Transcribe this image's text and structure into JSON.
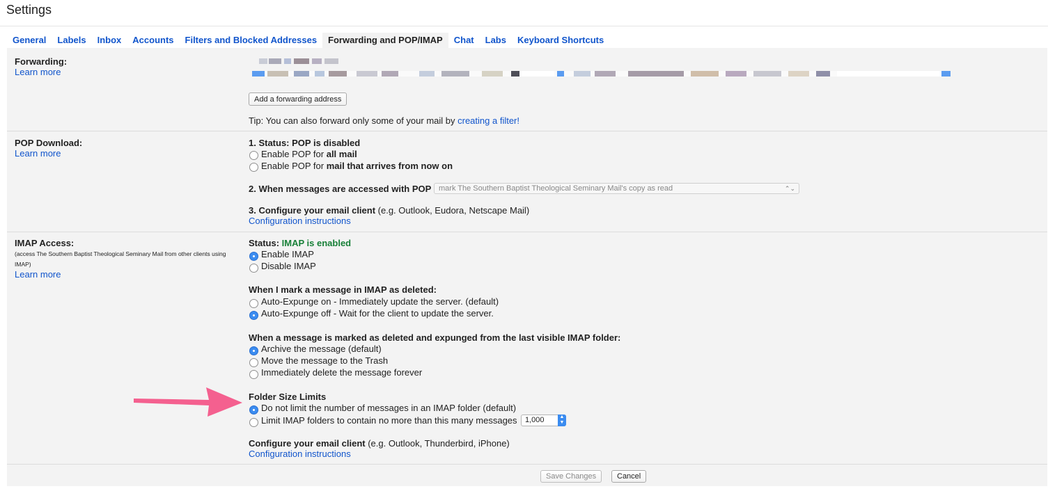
{
  "page": {
    "title": "Settings"
  },
  "tabs": [
    {
      "label": "General",
      "active": false
    },
    {
      "label": "Labels",
      "active": false
    },
    {
      "label": "Inbox",
      "active": false
    },
    {
      "label": "Accounts",
      "active": false
    },
    {
      "label": "Filters and Blocked Addresses",
      "active": false
    },
    {
      "label": "Forwarding and POP/IMAP",
      "active": true
    },
    {
      "label": "Chat",
      "active": false
    },
    {
      "label": "Labs",
      "active": false
    },
    {
      "label": "Keyboard Shortcuts",
      "active": false
    }
  ],
  "forwarding": {
    "label": "Forwarding:",
    "learn_more": "Learn more",
    "add_button": "Add a forwarding address",
    "tip_prefix": "Tip: You can also forward only some of your mail by ",
    "tip_link": "creating a filter!"
  },
  "pop": {
    "label": "POP Download:",
    "learn_more": "Learn more",
    "status_prefix": "1. Status: POP is ",
    "status_value": "disabled",
    "opt1_prefix": "Enable POP for ",
    "opt1_bold": "all mail",
    "opt2_prefix": "Enable POP for ",
    "opt2_bold": "mail that arrives from now on",
    "accessed_label": "2. When messages are accessed with POP",
    "accessed_select": "mark The Southern Baptist Theological Seminary Mail's copy as read",
    "configure_bold": "3. Configure your email client",
    "configure_rest": " (e.g. Outlook, Eudora, Netscape Mail)",
    "config_link": "Configuration instructions"
  },
  "imap": {
    "label": "IMAP Access:",
    "sublabel": "(access The Southern Baptist Theological Seminary Mail from other clients using IMAP)",
    "learn_more": "Learn more",
    "status_prefix": "Status: ",
    "status_value": "IMAP is enabled",
    "enable": "Enable IMAP",
    "disable": "Disable IMAP",
    "deleted_heading": "When I mark a message in IMAP as deleted:",
    "expunge_on": "Auto-Expunge on - Immediately update the server. (default)",
    "expunge_off": "Auto-Expunge off - Wait for the client to update the server.",
    "expunged_heading": "When a message is marked as deleted and expunged from the last visible IMAP folder:",
    "archive": "Archive the message (default)",
    "trash": "Move the message to the Trash",
    "delete_forever": "Immediately delete the message forever",
    "folder_heading": "Folder Size Limits",
    "no_limit": "Do not limit the number of messages in an IMAP folder (default)",
    "limit": "Limit IMAP folders to contain no more than this many messages",
    "limit_value": "1,000",
    "configure_bold": "Configure your email client",
    "configure_rest": " (e.g. Outlook, Thunderbird, iPhone)",
    "config_link": "Configuration instructions"
  },
  "footer": {
    "save": "Save Changes",
    "cancel": "Cancel"
  },
  "colors": {
    "link": "#1155cc",
    "enabled_green": "#188038",
    "arrow": "#f4608f",
    "radio_selected": "#3b8cf0"
  }
}
